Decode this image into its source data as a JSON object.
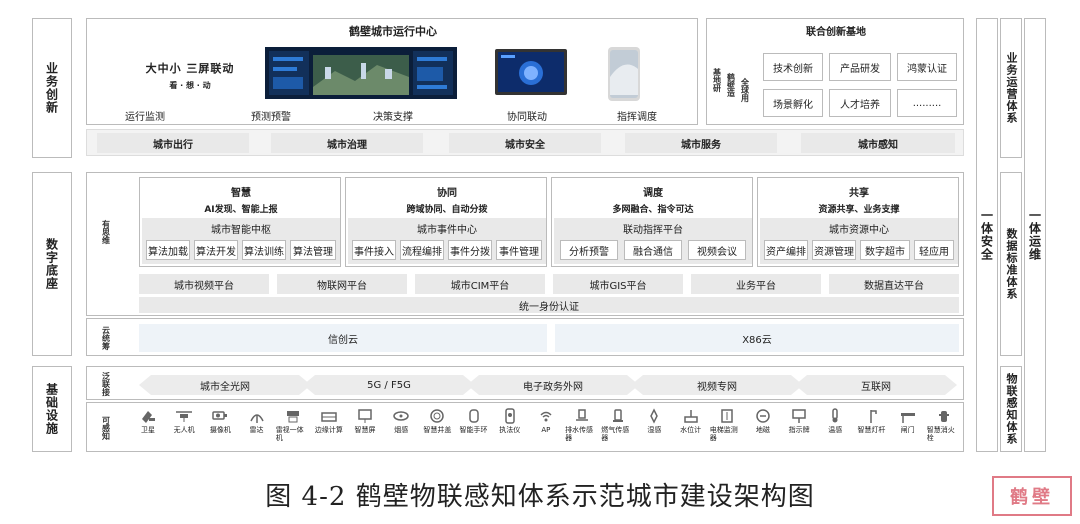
{
  "left_labels": [
    "业务创新",
    "数字底座",
    "基础设施"
  ],
  "top": {
    "title": "鹤壁城市运行中心",
    "slogan_main": "大中小 三屏联动",
    "slogan_sub": "看 · 想 · 动",
    "functions": [
      "运行监测",
      "预测预警",
      "决策支撑",
      "协同联动",
      "指挥调度"
    ],
    "scenes": [
      "城市出行",
      "城市治理",
      "城市安全",
      "城市服务",
      "城市感知"
    ]
  },
  "joint": {
    "title": "联合创新基地",
    "side_a": "基地研",
    "side_b": "鹤壁造",
    "side_c": "全球用",
    "items": [
      "技术创新",
      "产品研发",
      "鸿蒙认证",
      "场景孵化",
      "人才培养",
      "........."
    ]
  },
  "digital": {
    "side_label": "有思维",
    "columns": [
      {
        "title": "智慧",
        "sub": "AI发现、智能上报",
        "center": "城市智能中枢",
        "items": [
          "算法加载",
          "算法开发",
          "算法训练",
          "算法管理"
        ]
      },
      {
        "title": "协同",
        "sub": "跨域协同、自动分拨",
        "center": "城市事件中心",
        "items": [
          "事件接入",
          "流程编排",
          "事件分拨",
          "事件管理"
        ]
      },
      {
        "title": "调度",
        "sub": "多网融合、指令可达",
        "center": "联动指挥平台",
        "items": [
          "分析预警",
          "融合通信",
          "视频会议"
        ]
      },
      {
        "title": "共享",
        "sub": "资源共享、业务支撑",
        "center": "城市资源中心",
        "items": [
          "资产编排",
          "资源管理",
          "数字超市",
          "轻应用"
        ]
      }
    ],
    "platforms": [
      "城市视频平台",
      "物联网平台",
      "城市CIM平台",
      "城市GIS平台",
      "业务平台",
      "数据直达平台"
    ],
    "auth": "统一身份认证",
    "cloud_label": "云统筹",
    "clouds": [
      "信创云",
      "X86云"
    ]
  },
  "infra": {
    "net_label": "泛联接",
    "networks": [
      "城市全光网",
      "5G / F5G",
      "电子政务外网",
      "视频专网",
      "互联网"
    ],
    "sense_label": "可感知",
    "sensors": [
      "卫星",
      "无人机",
      "摄像机",
      "雷达",
      "雷视一体机",
      "边缘计算",
      "智慧屏",
      "烟感",
      "智慧井盖",
      "智能手环",
      "执法仪",
      "AP",
      "排水传感器",
      "燃气传感器",
      "湿感",
      "水位计",
      "电梯监测器",
      "地磁",
      "指示牌",
      "温感",
      "智慧灯杆",
      "闸门",
      "智慧消火栓"
    ]
  },
  "right": {
    "security": "一体安全",
    "ops_system": "业务运营体系",
    "data_std": "数据标准体系",
    "iot_system": "物联感知体系",
    "ops": "一体运维"
  },
  "caption": "图 4-2  鹤壁物联感知体系示范城市建设架构图",
  "stamp": "鹤壁"
}
